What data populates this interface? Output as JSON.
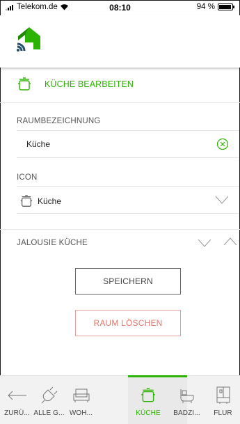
{
  "status_bar": {
    "carrier": "Telekom.de",
    "time": "08:10",
    "battery": "94 %",
    "battery_level": 0.94
  },
  "header": {
    "logo_icon": "home-wifi-logo-icon"
  },
  "edit_section": {
    "icon": "pot-icon",
    "title": "KÜCHE BEARBEITEN"
  },
  "form": {
    "room_name": {
      "label": "RAUMBEZEICHNUNG",
      "value": "Küche",
      "clear_icon": "clear-circle-icon"
    },
    "icon": {
      "label": "ICON",
      "selected_icon": "pot-icon",
      "selected_value": "Küche"
    },
    "jalousie": {
      "label": "JALOUSIE KÜCHE"
    }
  },
  "buttons": {
    "save": "SPEICHERN",
    "delete": "RAUM LÖSCHEN"
  },
  "tabbar": {
    "active": 4,
    "tabs": [
      {
        "label": "ZURÜ...",
        "icon": "arrow-left-icon"
      },
      {
        "label": "ALLE G...",
        "icon": "plug-icon"
      },
      {
        "label": "WOH...",
        "icon": "sofa-icon"
      },
      {
        "label": "KÜCHE",
        "icon": "pot-icon"
      },
      {
        "label": "BADZI...",
        "icon": "bathtub-icon"
      },
      {
        "label": "FLUR",
        "icon": "wardrobe-icon"
      }
    ]
  },
  "colors": {
    "accent": "#2bb300",
    "danger": "#e0776b"
  }
}
